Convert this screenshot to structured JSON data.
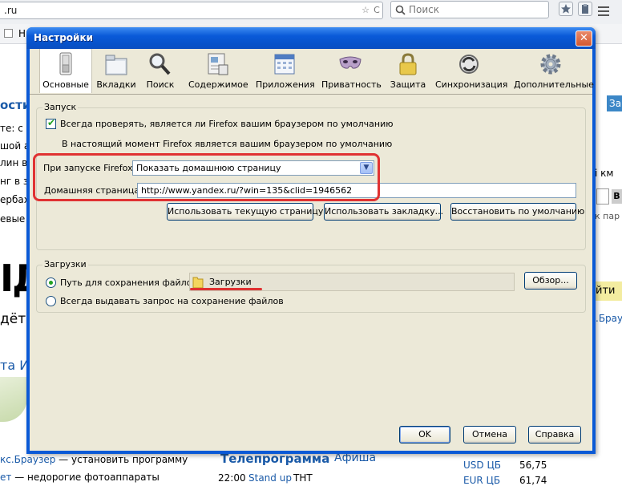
{
  "background_page": {
    "url_text": ".ru",
    "url_reload": "C",
    "url_star": "☆",
    "search_placeholder": "Поиск",
    "bookmark_label": "Н",
    "left_lines": [
      "ости",
      "те: с",
      "шой а",
      "лин в",
      "нг в з",
      "ербах",
      "евые"
    ],
    "big_letters": "ІД",
    "line_idet": "дёт",
    "left_link": "та И",
    "right_top_button": "За",
    "right_km": "і км",
    "right_par": "к пар",
    "right_iti": "йти",
    "right_brau": ".Брау",
    "right_btn_text": "В",
    "bottom_links": [
      {
        "link": "кс.Браузер",
        "text": " — установить программу"
      },
      {
        "link": "ет",
        "text": " — недорогие фотоаппараты"
      }
    ],
    "tv": {
      "title": "Телепрограмма",
      "afisha": "Афиша",
      "time": "22:00",
      "show": "Stand up",
      "channel": "ТНТ"
    },
    "rates": [
      {
        "name": "USD ЦБ",
        "value": "56,75"
      },
      {
        "name": "EUR ЦБ",
        "value": "61,74"
      }
    ]
  },
  "dialog": {
    "title": "Настройки",
    "close_symbol": "✕",
    "tabs": [
      {
        "label": "Основные",
        "icon": "general-switch-icon",
        "selected": true
      },
      {
        "label": "Вкладки",
        "icon": "tabs-folder-icon",
        "selected": false
      },
      {
        "label": "Поиск",
        "icon": "magnifier-icon",
        "selected": false
      },
      {
        "label": "Содержимое",
        "icon": "content-page-icon",
        "selected": false
      },
      {
        "label": "Приложения",
        "icon": "applications-calendar-icon",
        "selected": false
      },
      {
        "label": "Приватность",
        "icon": "privacy-mask-icon",
        "selected": false
      },
      {
        "label": "Защита",
        "icon": "security-lock-icon",
        "selected": false
      },
      {
        "label": "Синхронизация",
        "icon": "sync-arrows-icon",
        "selected": false
      },
      {
        "label": "Дополнительные",
        "icon": "advanced-gear-icon",
        "selected": false
      }
    ],
    "startup": {
      "group_title": "Запуск",
      "default_browser_check_label": "Всегда проверять, является ли Firefox вашим браузером по умолчанию",
      "default_browser_check_mark": "✔",
      "default_browser_status": "В настоящий момент Firefox является вашим браузером по умолчанию",
      "on_start_label": "При запуске Firefox:",
      "on_start_value": "Показать домашнюю страницу",
      "combo_arrow": "▼",
      "homepage_label": "Домашняя страница:",
      "homepage_value": "http://www.yandex.ru/?win=135&clid=1946562",
      "btn_use_current": "Использовать текущую страницу",
      "btn_use_bookmark": "Использовать закладку...",
      "btn_restore_default": "Восстановить по умолчанию"
    },
    "downloads": {
      "group_title": "Загрузки",
      "save_path_label": "Путь для сохранения файлов",
      "save_path_value": "Загрузки",
      "browse_button": "Обзор...",
      "always_ask_label": "Всегда выдавать запрос на сохранение файлов",
      "selected_option": "save_path"
    },
    "buttons": {
      "ok": "OK",
      "cancel": "Отмена",
      "help": "Справка"
    }
  },
  "colors": {
    "titlebar": "#0a59d6",
    "client_bg": "#ece9d8",
    "highlight_red": "#e03232",
    "link_blue": "#1a5aa8"
  }
}
